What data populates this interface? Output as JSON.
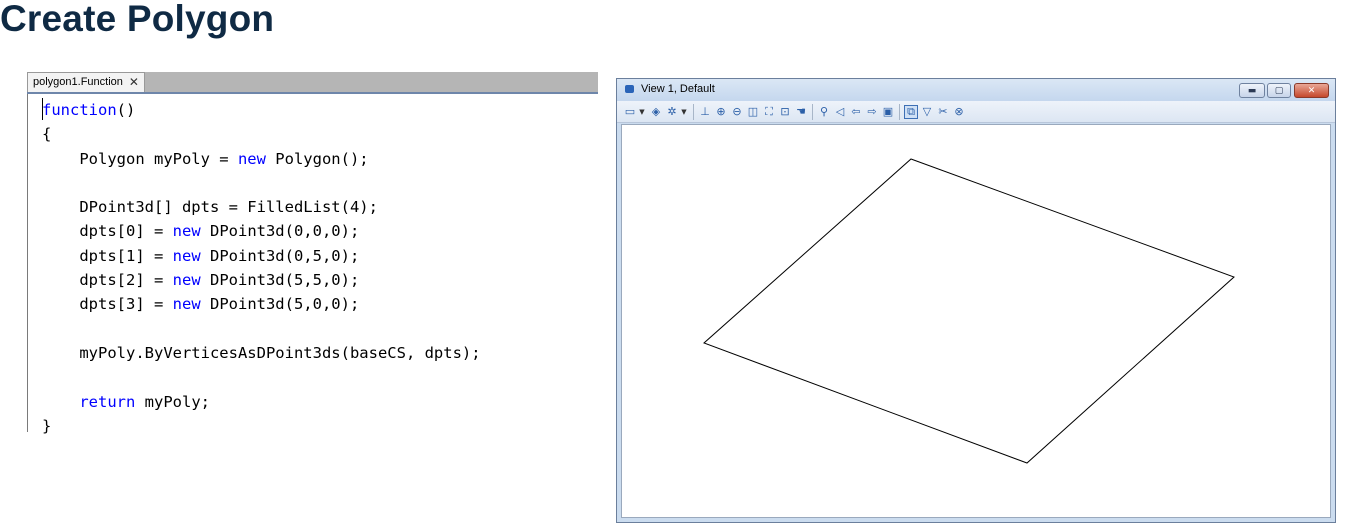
{
  "page": {
    "title": "Create Polygon"
  },
  "editor": {
    "tab_label": "polygon1.Function",
    "tab_close_glyph": "✕",
    "lines": [
      [
        {
          "t": "function",
          "c": "kw"
        },
        {
          "t": "()",
          "c": ""
        }
      ],
      [
        {
          "t": "{",
          "c": ""
        }
      ],
      [
        {
          "t": "    Polygon myPoly = ",
          "c": ""
        },
        {
          "t": "new",
          "c": "kw"
        },
        {
          "t": " Polygon();",
          "c": ""
        }
      ],
      [],
      [
        {
          "t": "    DPoint3d[] dpts = FilledList(4);",
          "c": ""
        }
      ],
      [
        {
          "t": "    dpts[0] = ",
          "c": ""
        },
        {
          "t": "new",
          "c": "kw"
        },
        {
          "t": " DPoint3d(0,0,0);",
          "c": ""
        }
      ],
      [
        {
          "t": "    dpts[1] = ",
          "c": ""
        },
        {
          "t": "new",
          "c": "kw"
        },
        {
          "t": " DPoint3d(0,5,0);",
          "c": ""
        }
      ],
      [
        {
          "t": "    dpts[2] = ",
          "c": ""
        },
        {
          "t": "new",
          "c": "kw"
        },
        {
          "t": " DPoint3d(5,5,0);",
          "c": ""
        }
      ],
      [
        {
          "t": "    dpts[3] = ",
          "c": ""
        },
        {
          "t": "new",
          "c": "kw"
        },
        {
          "t": " DPoint3d(5,0,0);",
          "c": ""
        }
      ],
      [],
      [
        {
          "t": "    myPoly.ByVerticesAsDPoint3ds(baseCS, dpts);",
          "c": ""
        }
      ],
      [],
      [
        {
          "t": "    ",
          "c": ""
        },
        {
          "t": "return",
          "c": "kw"
        },
        {
          "t": " myPoly;",
          "c": ""
        }
      ],
      [
        {
          "t": "}",
          "c": ""
        }
      ]
    ]
  },
  "view": {
    "title": "View 1, Default",
    "window_buttons": {
      "minimize": "▬",
      "maximize": "▢",
      "close": "✕"
    },
    "toolbar": [
      {
        "icon": "view-attributes-icon",
        "glyph": "▭",
        "dropdown": true
      },
      {
        "icon": "display-style-icon",
        "glyph": "◈",
        "dropdown": false
      },
      {
        "icon": "lighting-icon",
        "glyph": "✲",
        "dropdown": true
      },
      {
        "sep": true
      },
      {
        "icon": "update-view-icon",
        "glyph": "⊥",
        "dropdown": false
      },
      {
        "icon": "zoom-in-icon",
        "glyph": "⊕",
        "dropdown": false
      },
      {
        "icon": "zoom-out-icon",
        "glyph": "⊖",
        "dropdown": false
      },
      {
        "icon": "window-area-icon",
        "glyph": "◫",
        "dropdown": false
      },
      {
        "icon": "fit-view-icon",
        "glyph": "⛶",
        "dropdown": false
      },
      {
        "icon": "rotate-view-icon",
        "glyph": "⊡",
        "dropdown": false
      },
      {
        "icon": "pan-view-icon",
        "glyph": "☚",
        "dropdown": false
      },
      {
        "sep": true
      },
      {
        "icon": "walk-icon",
        "glyph": "⚲",
        "dropdown": false
      },
      {
        "icon": "fly-icon",
        "glyph": "◁",
        "dropdown": false
      },
      {
        "icon": "view-previous-icon",
        "glyph": "⇦",
        "dropdown": false
      },
      {
        "icon": "view-next-icon",
        "glyph": "⇨",
        "dropdown": false
      },
      {
        "icon": "copy-view-icon",
        "glyph": "▣",
        "dropdown": false
      },
      {
        "sep": true
      },
      {
        "icon": "view-rotation-icon",
        "glyph": "⧉",
        "dropdown": false,
        "active": true
      },
      {
        "icon": "clip-volume-icon",
        "glyph": "▽",
        "dropdown": false
      },
      {
        "icon": "clip-mask-icon",
        "glyph": "✂",
        "dropdown": false
      },
      {
        "icon": "camera-icon",
        "glyph": "⊗",
        "dropdown": false
      }
    ],
    "stroke_color": "#000000"
  }
}
